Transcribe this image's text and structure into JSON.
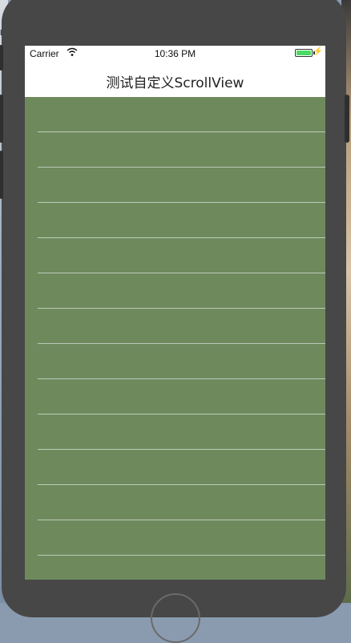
{
  "desktop_fragment": "E",
  "status_bar": {
    "carrier": "Carrier",
    "time": "10:36 PM",
    "battery_level": 1.0,
    "battery_color": "#4cd964",
    "wifi_icon": "wifi-icon",
    "charging_icon": "charging-bolt-icon"
  },
  "nav_bar": {
    "title": "测试自定义ScrollView"
  },
  "scroll_view": {
    "background": "#6e8a5d",
    "row_count": 13
  }
}
